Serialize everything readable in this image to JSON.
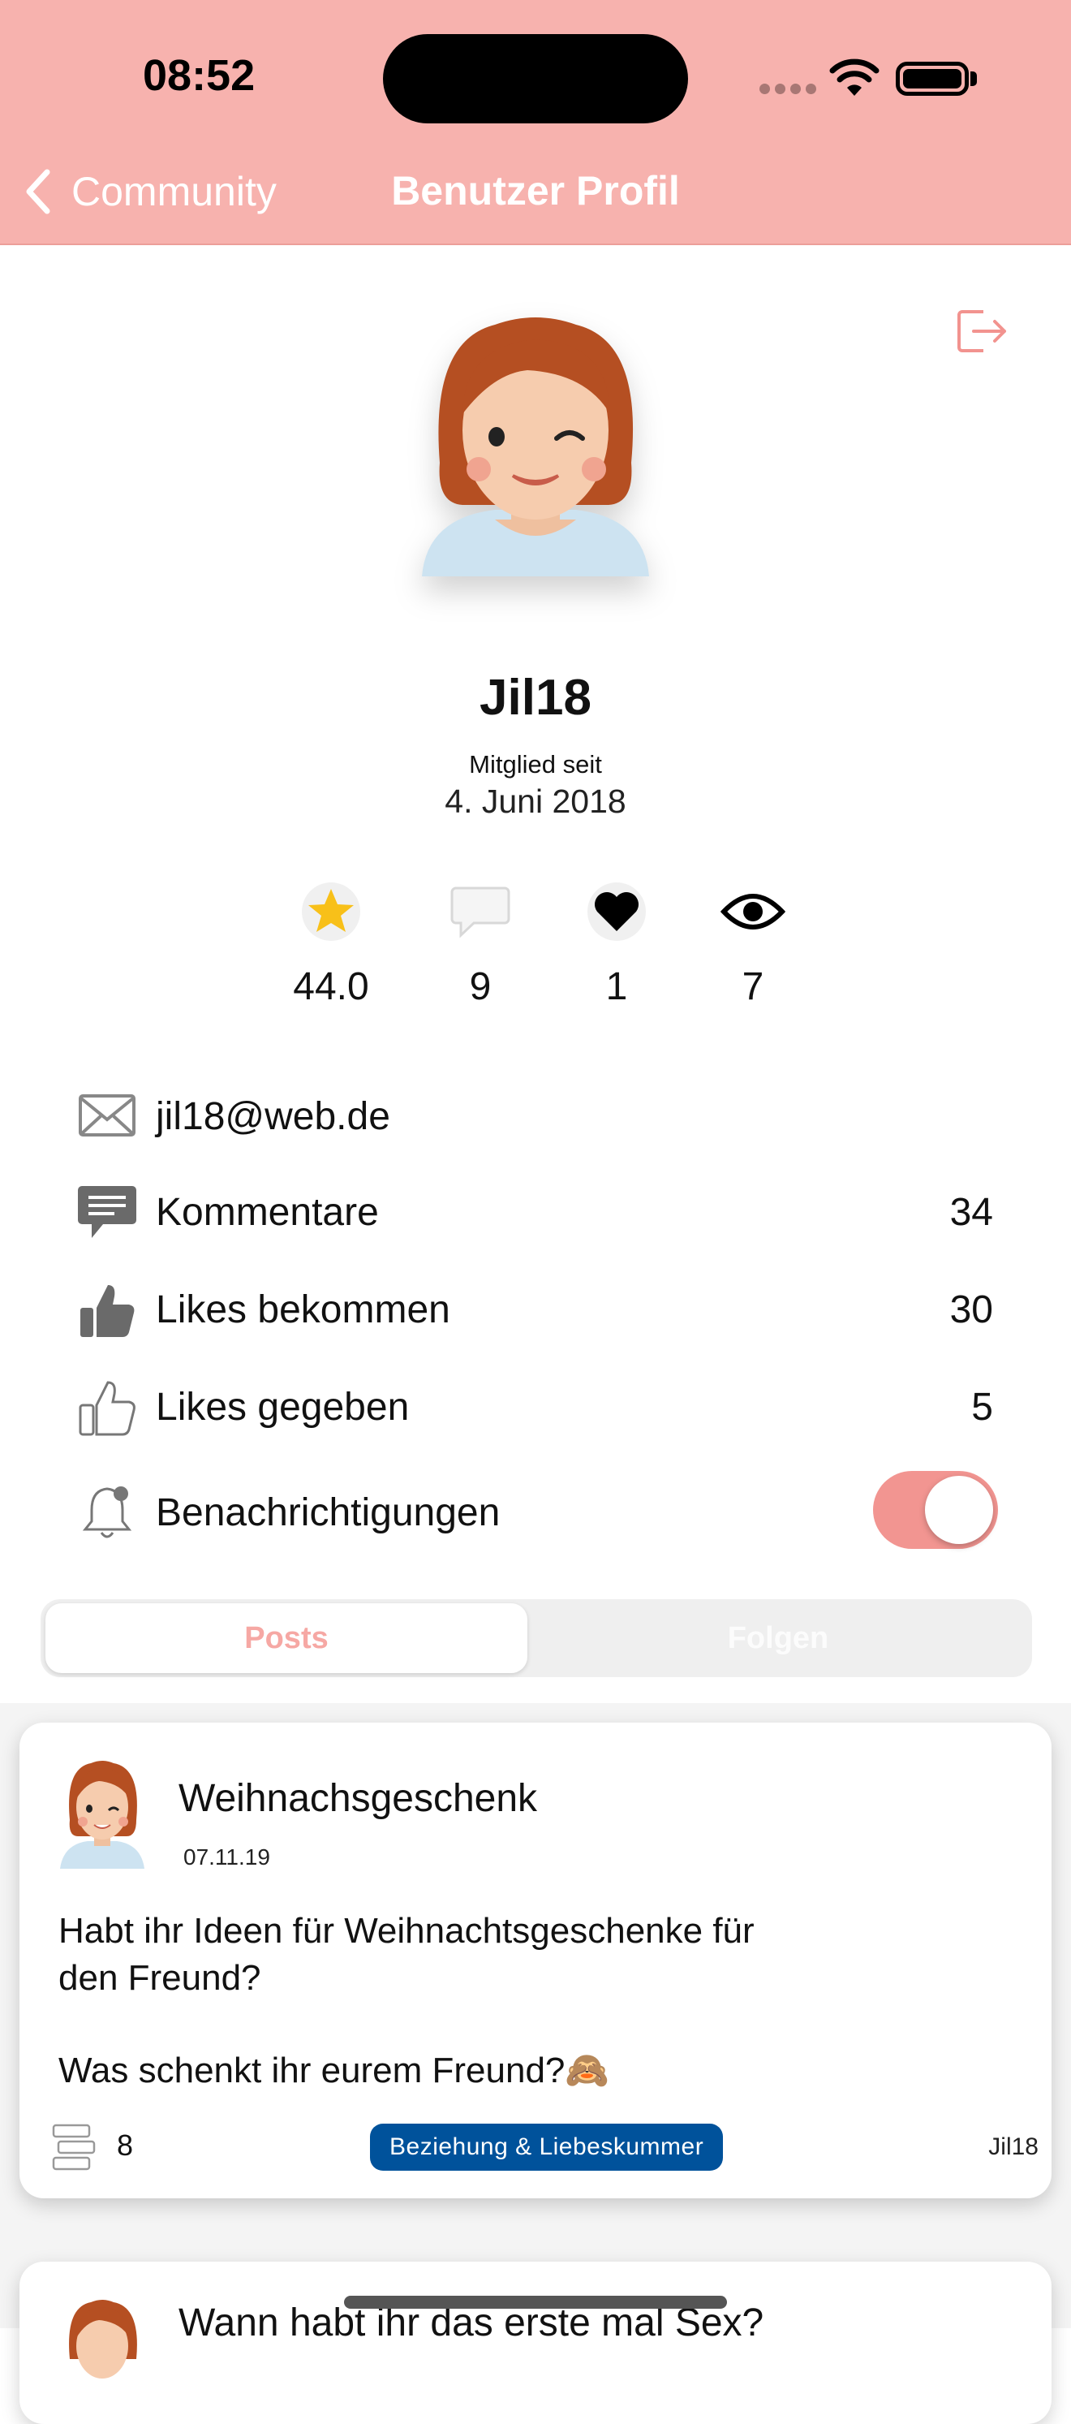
{
  "status_bar": {
    "time": "08:52"
  },
  "nav": {
    "back_label": "Community",
    "title": "Benutzer Profil"
  },
  "profile": {
    "username": "Jil18",
    "member_since_label": "Mitglied seit",
    "member_since_date": "4. Juni 2018"
  },
  "stats": [
    {
      "icon": "star-icon",
      "value": "44.0"
    },
    {
      "icon": "comment-bubble-icon",
      "value": "9"
    },
    {
      "icon": "heart-icon",
      "value": "1"
    },
    {
      "icon": "eye-icon",
      "value": "7"
    }
  ],
  "info": {
    "email": "jil18@web.de",
    "comments_label": "Kommentare",
    "comments_count": "34",
    "likes_received_label": "Likes bekommen",
    "likes_received_count": "30",
    "likes_given_label": "Likes gegeben",
    "likes_given_count": "5",
    "notifications_label": "Benachrichtigungen",
    "notifications_on": true
  },
  "tabs": {
    "posts": "Posts",
    "following": "Folgen",
    "active": "Posts"
  },
  "posts": [
    {
      "title": "Weihnachsgeschenk",
      "date": "07.11.19",
      "body_line1": "Habt ihr Ideen für Weihnachtsgeschenke für",
      "body_line2": "den Freund?",
      "body_line3": "Was schenkt ihr eurem Freund?🙈",
      "comments": "8",
      "category": "Beziehung & Liebeskummer",
      "author": "Jil18"
    },
    {
      "title": "Wann habt ihr das erste mal Sex?"
    }
  ],
  "colors": {
    "header": "#f7b2ae",
    "accent": "#f29591",
    "tag": "#00529b"
  }
}
